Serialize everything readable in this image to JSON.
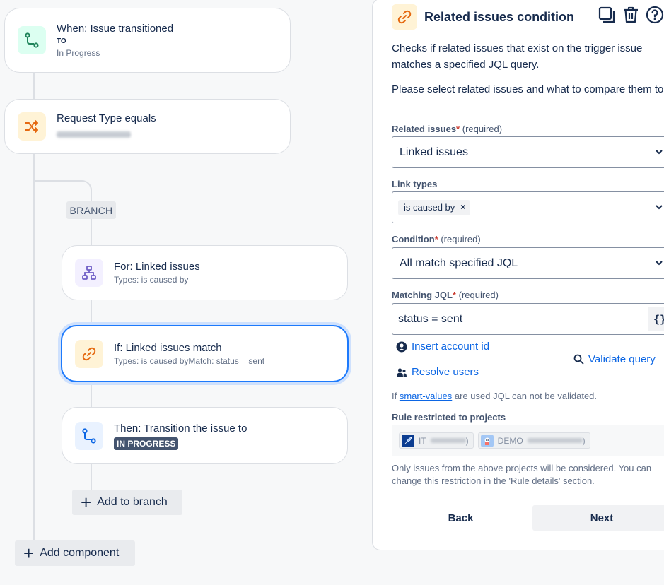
{
  "rule": {
    "trigger": {
      "title": "When: Issue transitioned",
      "to_label": "TO",
      "to_value": "In Progress",
      "icon": "transition-icon"
    },
    "condition": {
      "title": "Request Type equals",
      "icon": "shuffle-icon"
    },
    "branch_label": "BRANCH",
    "branch_for": {
      "title": "For: Linked issues",
      "subtitle": "Types: is caused by",
      "icon": "hierarchy-icon"
    },
    "branch_if": {
      "title": "If: Linked issues match",
      "subtitle": "Types: is caused byMatch: status = sent",
      "icon": "link-icon"
    },
    "branch_then": {
      "title": "Then: Transition the issue to",
      "status_lozenge": "IN PROGRESS",
      "icon": "transition-icon"
    },
    "add_to_branch": "Add to branch",
    "add_component": "Add component"
  },
  "panel": {
    "title": "Related issues condition",
    "description": "Checks if related issues that exist on the trigger issue matches a specified JQL query.",
    "instruction": "Please select related issues and what to compare them to:",
    "related_issues": {
      "label": "Related issues",
      "required_marker": "*",
      "required_text": "(required)",
      "value": "Linked issues"
    },
    "link_types": {
      "label": "Link types",
      "chip": "is caused by",
      "chip_remove": "×"
    },
    "condition": {
      "label": "Condition",
      "required_marker": "*",
      "required_text": "(required)",
      "value": "All match specified JQL"
    },
    "matching_jql": {
      "label": "Matching JQL",
      "required_marker": "*",
      "required_text": "(required)",
      "value": "status = sent",
      "button": "{}"
    },
    "insert_account_id": "Insert account id",
    "resolve_users": "Resolve users",
    "validate_query": "Validate query",
    "smart_values_prefix": "If ",
    "smart_values_link": "smart-values",
    "smart_values_suffix": " are used JQL can not be validated.",
    "restricted_label": "Rule restricted to projects",
    "projects": [
      {
        "prefix": "IT",
        "suffix": ")"
      },
      {
        "prefix": "DEMO",
        "suffix": ")"
      }
    ],
    "restriction_note": "Only issues from the above projects will be considered. You can change this restriction in the 'Rule details' section.",
    "back_button": "Back",
    "next_button": "Next"
  },
  "colors": {
    "accent_blue": "#0c66e4",
    "selected_border": "#1d7afc",
    "required_red": "#c9372c"
  }
}
